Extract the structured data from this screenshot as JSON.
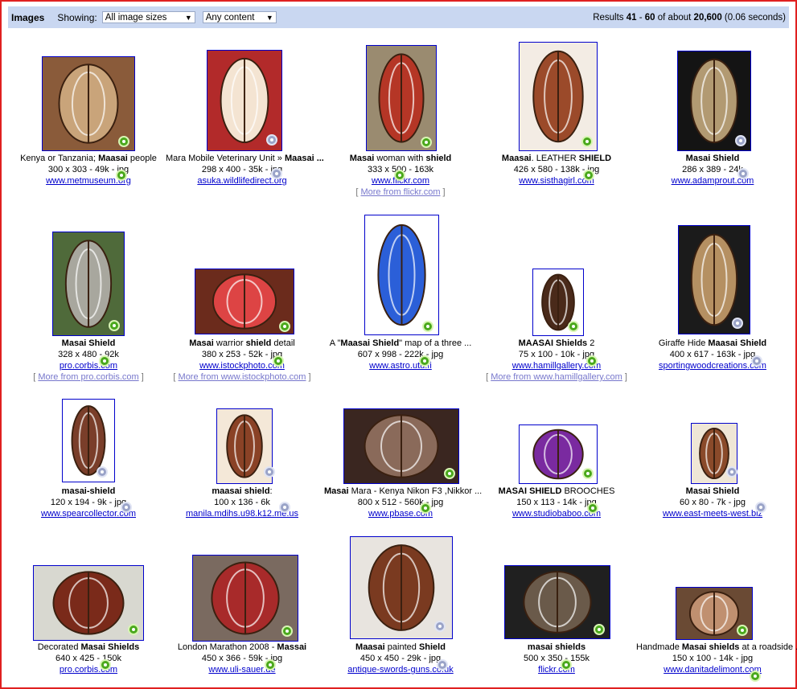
{
  "toolbar": {
    "brand": "Images",
    "showing_label": "Showing:",
    "size_select": "All image sizes",
    "content_select": "Any content",
    "results_pre": "Results ",
    "results_range_start": "41",
    "results_dash": " - ",
    "results_range_end": "60",
    "results_mid": " of about ",
    "results_total": "20,600",
    "results_time": " (0.06 seconds)"
  },
  "results": [
    {
      "title_html": "Kenya or Tanzania; <b>Maasai</b> people",
      "info": "300 x 303 - 49k - jpg",
      "site": "www.metmuseum.org",
      "more": "",
      "bg": "#8a5b3a",
      "fg": "#c9a47a"
    },
    {
      "title_html": "Mara Mobile Veterinary Unit » <b>Maasai ...</b>",
      "info": "298 x 400 - 35k - jpg",
      "site": "asuka.wildlifedirect.org",
      "more": "",
      "bg": "#b22a2a",
      "fg": "#f4e4d2"
    },
    {
      "title_html": "<b>Masai</b> woman with <b>shield</b>",
      "info": "333 x 500 - 163k",
      "site": "www.flickr.com",
      "more": "More from flickr.com",
      "bg": "#9a8b70",
      "fg": "#b53626"
    },
    {
      "title_html": "<b>Maasai</b>. LEATHER <b>SHIELD</b>",
      "info": "426 x 580 - 138k - jpg",
      "site": "www.sisthagirl.com",
      "more": "",
      "bg": "#f3ece4",
      "fg": "#9b4a2a"
    },
    {
      "title_html": "<b>Masai Shield</b>",
      "info": "286 x 389 - 24k",
      "site": "www.adamprout.com",
      "more": "",
      "bg": "#141414",
      "fg": "#b29a72"
    },
    {
      "title_html": "<b>Masai Shield</b>",
      "info": "328 x 480 - 92k",
      "site": "pro.corbis.com",
      "more": "More from pro.corbis.com",
      "bg": "#4f6a3a",
      "fg": "#a8a79e"
    },
    {
      "title_html": "<b>Masai</b> warrior <b>shield</b> detail",
      "info": "380 x 253 - 52k - jpg",
      "site": "www.istockphoto.com",
      "more": "More from www.istockphoto.com",
      "bg": "#6b2b1c",
      "fg": "#d44"
    },
    {
      "title_html": "A \"<b>Maasai Shield</b>\" map of a three ...",
      "info": "607 x 998 - 222k - jpg",
      "site": "www.astro.utu.fi",
      "more": "",
      "bg": "#ffffff",
      "fg": "#2b5fd8"
    },
    {
      "title_html": "<b>MAASAI Shields</b> 2",
      "info": "75 x 100 - 10k - jpg",
      "site": "www.hamillgallery.com",
      "more": "More from www.hamillgallery.com",
      "bg": "#ffffff",
      "fg": "#4a2a1a"
    },
    {
      "title_html": "Giraffe Hide <b>Maasai Shield</b>",
      "info": "400 x 617 - 163k - jpg",
      "site": "sportingwoodcreations.com",
      "more": "",
      "bg": "#1b1b1b",
      "fg": "#b59062"
    },
    {
      "title_html": "<b>masai-shield</b>",
      "info": "120 x 194 - 9k - jpg",
      "site": "www.spearcollector.com",
      "more": "",
      "bg": "#ffffff",
      "fg": "#7a3e2a"
    },
    {
      "title_html": "<b>maasai shield</b>:",
      "info": "100 x 136 - 6k",
      "site": "manila.mdihs.u98.k12.me.us",
      "more": "",
      "bg": "#f4e8d8",
      "fg": "#8a4226"
    },
    {
      "title_html": "<b>Masai</b> Mara - Kenya Nikon F3 ,Nikkor ...",
      "info": "800 x 512 - 560k - jpg",
      "site": "www.pbase.com",
      "more": "",
      "bg": "#3a2620",
      "fg": "#8a6a5a"
    },
    {
      "title_html": "<b>MASAI SHIELD</b> BROOCHES",
      "info": "150 x 113 - 14k - jpg",
      "site": "www.studiobaboo.com",
      "more": "",
      "bg": "#ffffff",
      "fg": "#7a2aa0"
    },
    {
      "title_html": "<b>Masai Shield</b>",
      "info": "60 x 80 - 7k - jpg",
      "site": "www.east-meets-west.biz",
      "more": "",
      "bg": "#efe6d6",
      "fg": "#8a4a2a"
    },
    {
      "title_html": "Decorated <b>Masai Shields</b>",
      "info": "640 x 425 - 150k",
      "site": "pro.corbis.com",
      "more": "",
      "bg": "#d8d8d0",
      "fg": "#7a2a1a"
    },
    {
      "title_html": "London Marathon 2008 - <b>Massai</b>",
      "info": "450 x 366 - 59k - jpg",
      "site": "www.uli-sauer.de",
      "more": "",
      "bg": "#7a6a60",
      "fg": "#a82a2a"
    },
    {
      "title_html": "<b>Maasai</b> painted <b>Shield</b>",
      "info": "450 x 450 - 29k - jpg",
      "site": "antique-swords-guns.co.uk",
      "more": "",
      "bg": "#e8e4df",
      "fg": "#7a3a20"
    },
    {
      "title_html": "<b>masai shields</b>",
      "info": "500 x 350 - 155k",
      "site": "flickr.com",
      "more": "",
      "bg": "#202020",
      "fg": "#6a5a4a"
    },
    {
      "title_html": "Handmade <b>Masai shields</b> at a roadside ...",
      "info": "150 x 100 - 14k - jpg",
      "site": "www.danitadelimont.com",
      "more": "",
      "bg": "#6a4a34",
      "fg": "#c09070"
    }
  ]
}
